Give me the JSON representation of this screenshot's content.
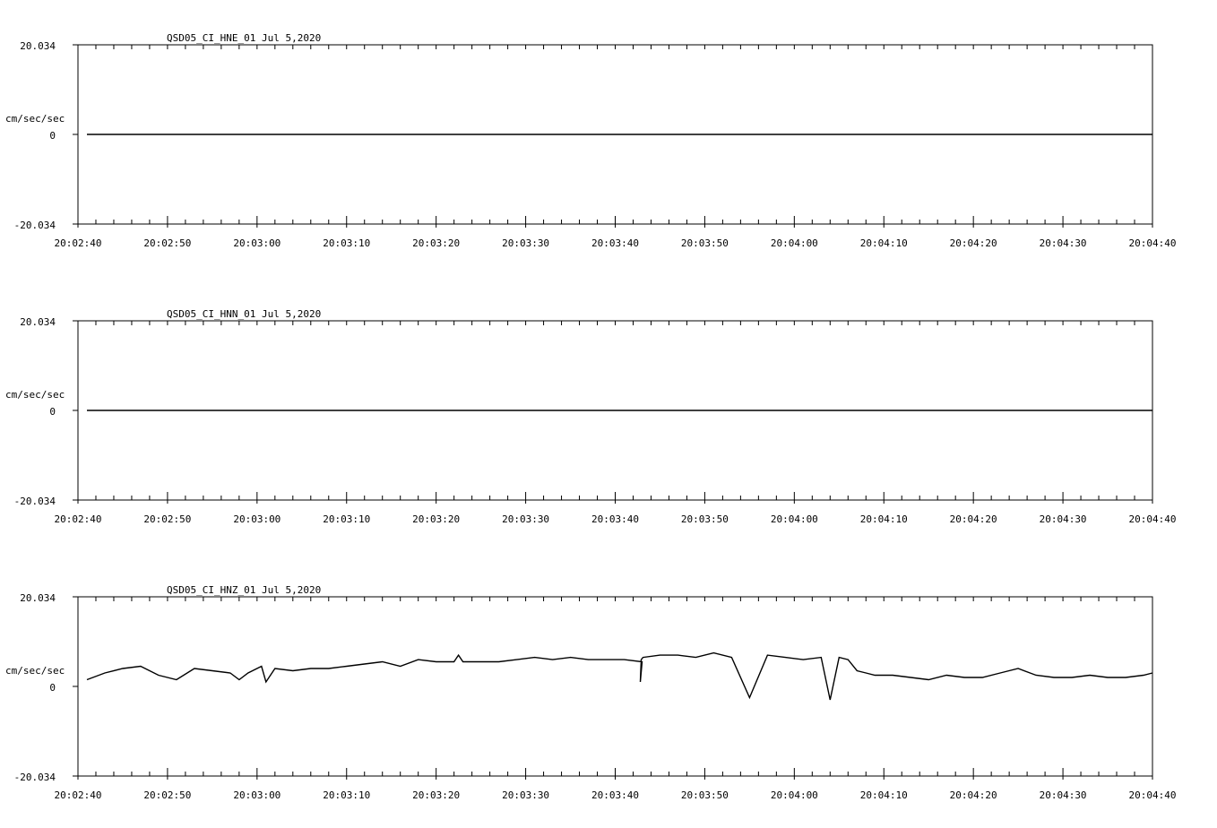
{
  "chart_data": [
    {
      "type": "line",
      "title": "QSD05_CI_HNE_01  Jul 5,2020",
      "ylabel": "cm/sec/sec",
      "ylim": [
        -20.034,
        20.034
      ],
      "y_tick_labels": [
        "20.034",
        "0",
        "-20.034"
      ],
      "x_tick_labels": [
        "20:02:40",
        "20:02:50",
        "20:03:00",
        "20:03:10",
        "20:03:20",
        "20:03:30",
        "20:03:40",
        "20:03:50",
        "20:04:00",
        "20:04:10",
        "20:04:20",
        "20:04:30",
        "20:04:40"
      ],
      "xlim_seconds": [
        0,
        120
      ],
      "series": [
        {
          "x": [
            1,
            120
          ],
          "y": [
            0,
            0
          ]
        }
      ]
    },
    {
      "type": "line",
      "title": "QSD05_CI_HNN_01  Jul 5,2020",
      "ylabel": "cm/sec/sec",
      "ylim": [
        -20.034,
        20.034
      ],
      "y_tick_labels": [
        "20.034",
        "0",
        "-20.034"
      ],
      "x_tick_labels": [
        "20:02:40",
        "20:02:50",
        "20:03:00",
        "20:03:10",
        "20:03:20",
        "20:03:30",
        "20:03:40",
        "20:03:50",
        "20:04:00",
        "20:04:10",
        "20:04:20",
        "20:04:30",
        "20:04:40"
      ],
      "xlim_seconds": [
        0,
        120
      ],
      "series": [
        {
          "x": [
            1,
            120
          ],
          "y": [
            0,
            0
          ]
        }
      ]
    },
    {
      "type": "line",
      "title": "QSD05_CI_HNZ_01  Jul 5,2020",
      "ylabel": "cm/sec/sec",
      "ylim": [
        -20.034,
        20.034
      ],
      "y_tick_labels": [
        "20.034",
        "0",
        "-20.034"
      ],
      "x_tick_labels": [
        "20:02:40",
        "20:02:50",
        "20:03:00",
        "20:03:10",
        "20:03:20",
        "20:03:30",
        "20:03:40",
        "20:03:50",
        "20:04:00",
        "20:04:10",
        "20:04:20",
        "20:04:30",
        "20:04:40"
      ],
      "xlim_seconds": [
        0,
        120
      ],
      "series": [
        {
          "x": [
            1,
            3,
            5,
            7,
            9,
            11,
            13,
            15,
            17,
            18,
            19,
            20.5,
            21,
            22,
            24,
            26,
            28,
            30,
            32,
            34,
            36,
            38,
            40,
            42,
            42.5,
            43,
            45,
            47,
            49,
            51,
            53,
            55,
            57,
            59,
            61,
            63,
            62.8,
            62.9,
            63.1,
            65,
            67,
            69,
            71,
            73,
            75,
            77,
            79,
            81,
            83,
            84,
            85,
            86,
            87,
            88,
            89,
            91,
            93,
            95,
            97,
            99,
            101,
            103,
            105,
            107,
            109,
            111,
            113,
            115,
            117,
            119,
            120
          ],
          "y": [
            1.5,
            3.0,
            4.0,
            4.5,
            2.5,
            1.5,
            4.0,
            3.5,
            3.0,
            1.5,
            3.0,
            4.5,
            1.0,
            4.0,
            3.5,
            4.0,
            4.0,
            4.5,
            5.0,
            5.5,
            4.5,
            6.0,
            5.5,
            5.5,
            7.0,
            5.5,
            5.5,
            5.5,
            6.0,
            6.5,
            6.0,
            6.5,
            6.0,
            6.0,
            6.0,
            5.5,
            1.0,
            6.0,
            6.5,
            7.0,
            7.0,
            6.5,
            7.5,
            6.5,
            -2.5,
            7.0,
            6.5,
            6.0,
            6.5,
            -3.0,
            6.5,
            6.0,
            3.5,
            3.0,
            2.5,
            2.5,
            2.0,
            1.5,
            2.5,
            2.0,
            2.0,
            3.0,
            4.0,
            2.5,
            2.0,
            2.0,
            2.5,
            2.0,
            2.0,
            2.5,
            3.0
          ]
        }
      ]
    }
  ]
}
